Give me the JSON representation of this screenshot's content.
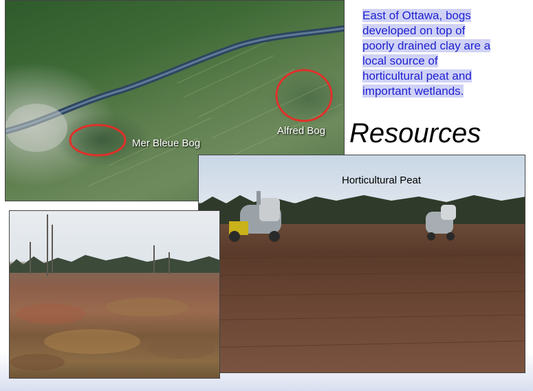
{
  "description": {
    "lines": [
      "East of Ottawa, bogs",
      "developed on top of",
      "poorly drained clay are a",
      "local source of",
      "horticultural peat and",
      "important wetlands."
    ]
  },
  "title": "Resources",
  "map": {
    "labels": {
      "mer_bleue": "Mer Bleue Bog",
      "alfred": "Alfred Bog"
    }
  },
  "peat_photo": {
    "caption": "Horticultural Peat"
  },
  "colors": {
    "text_blue": "#1f1fd0",
    "highlight": "#cfd2f5",
    "circle_red": "#e0302a"
  }
}
